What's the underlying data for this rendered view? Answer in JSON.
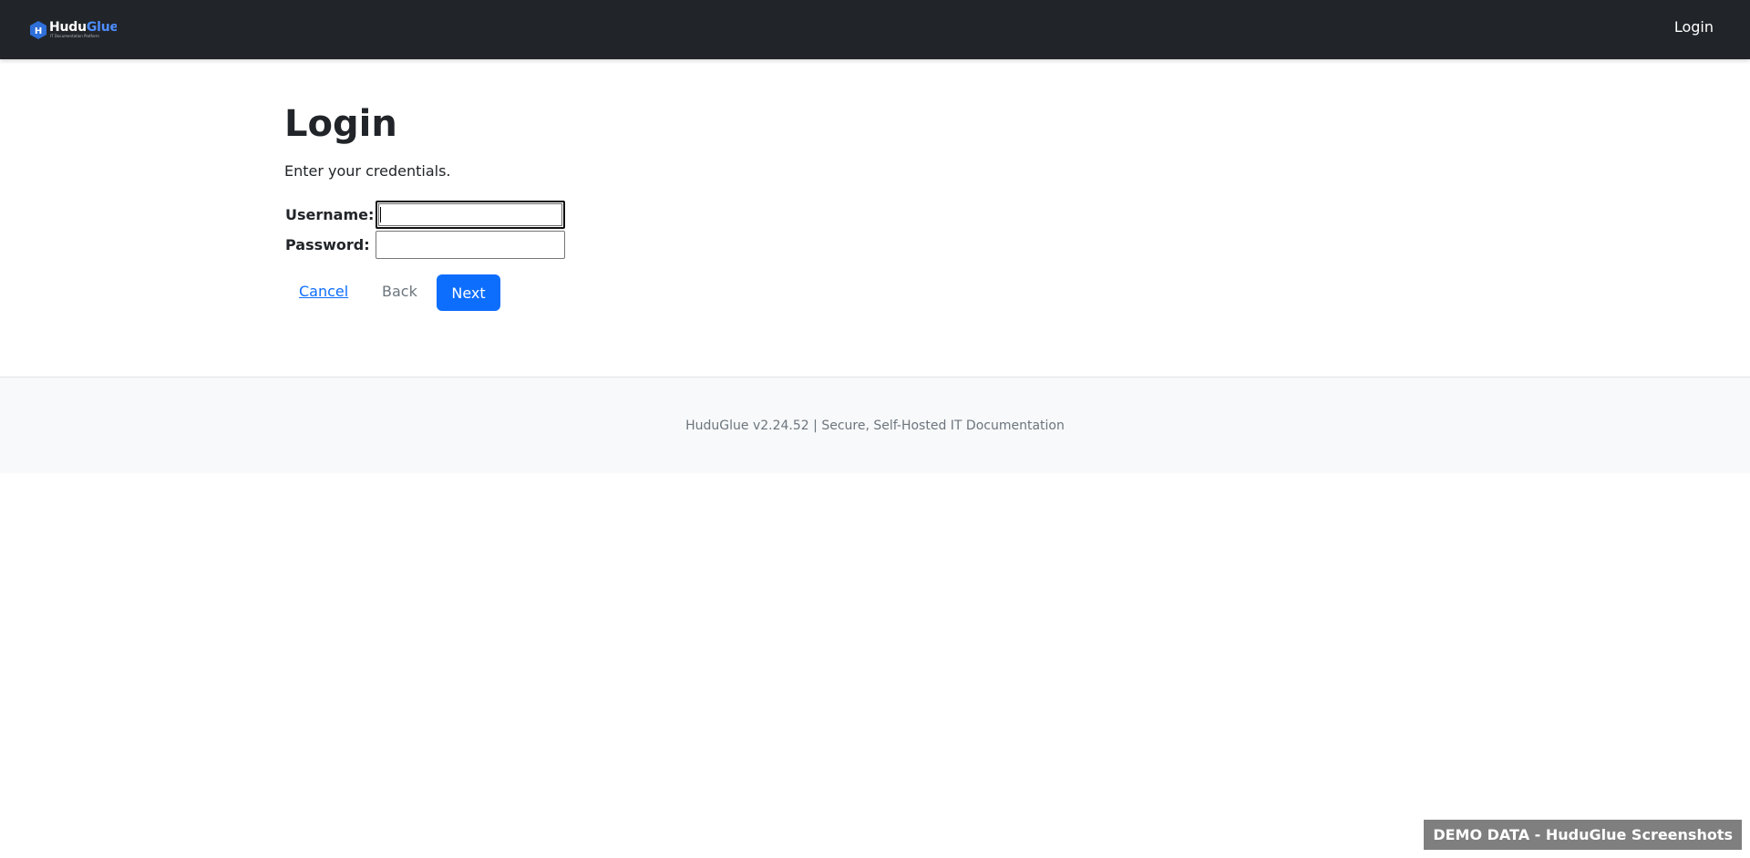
{
  "navbar": {
    "brand_part1": "Hudu",
    "brand_part2": "Glue",
    "brand_tagline": "IT Documentation Platform",
    "login_link": "Login",
    "background_color": "#212529"
  },
  "login": {
    "title": "Login",
    "subtitle": "Enter your credentials.",
    "username_label": "Username:",
    "username_value": "",
    "password_label": "Password:",
    "password_value": "",
    "cancel_label": "Cancel",
    "back_label": "Back",
    "next_label": "Next",
    "accent_color": "#0d6efd"
  },
  "footer": {
    "text": "HuduGlue v2.24.52 | Secure, Self-Hosted IT Documentation"
  },
  "badge": {
    "text": "DEMO DATA - HuduGlue Screenshots"
  },
  "icons": {
    "logo": "hexagon-h-logo-icon"
  }
}
